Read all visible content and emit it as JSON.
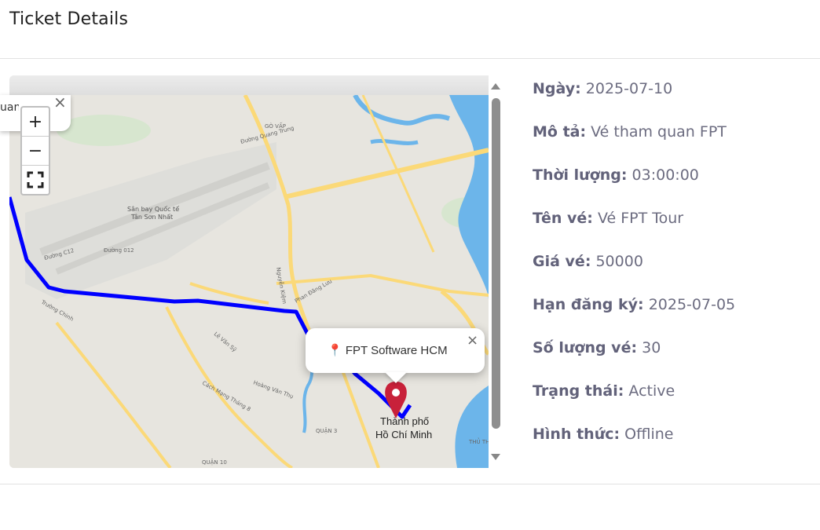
{
  "header": {
    "title": "Ticket Details"
  },
  "map": {
    "top_popup": {
      "text": "uan",
      "close": "×"
    },
    "zoom": {
      "in": "+",
      "out": "−",
      "fullscreen": "⛶"
    },
    "popup": {
      "text": "📍 FPT Software HCM",
      "close": "×"
    },
    "labels": {
      "airport_1": "Sân bay Quốc tế",
      "airport_2": "Tân Sơn Nhất",
      "city_1": "Thành phố",
      "city_2": "Hồ Chí Minh",
      "govap": "GÒ VẤP",
      "quan3": "QUẬN 3",
      "quan10": "QUẬN 10",
      "thuthiem": "THỦ TH",
      "d_quangtrung": "Đường Quang Trung",
      "d_c12": "Đường C12",
      "d_012": "Đường 012",
      "d_nguyenkiem": "Nguyễn Kiệm",
      "d_phandangluu": "Phan Đăng Lưu",
      "d_levanxy": "Lê Văn Sỹ",
      "d_cmt8": "Cách Mạng Tháng 8",
      "d_truongchinh": "Trường Chinh",
      "d_hoangvanthu": "Hoàng Văn Thụ"
    },
    "colors": {
      "route": "#0000ff",
      "marker": "#c8213a",
      "water": "#6cb5ea",
      "road": "#fbd978"
    }
  },
  "details": [
    {
      "label": "Ngày:",
      "value": "2025-07-10"
    },
    {
      "label": "Mô tả:",
      "value": "Vé tham quan FPT"
    },
    {
      "label": "Thời lượng:",
      "value": "03:00:00"
    },
    {
      "label": "Tên vé:",
      "value": "Vé FPT Tour"
    },
    {
      "label": "Giá vé:",
      "value": "50000"
    },
    {
      "label": "Hạn đăng ký:",
      "value": "2025-07-05"
    },
    {
      "label": "Số lượng vé:",
      "value": "30"
    },
    {
      "label": "Trạng thái:",
      "value": "Active"
    },
    {
      "label": "Hình thức:",
      "value": "Offline"
    }
  ]
}
